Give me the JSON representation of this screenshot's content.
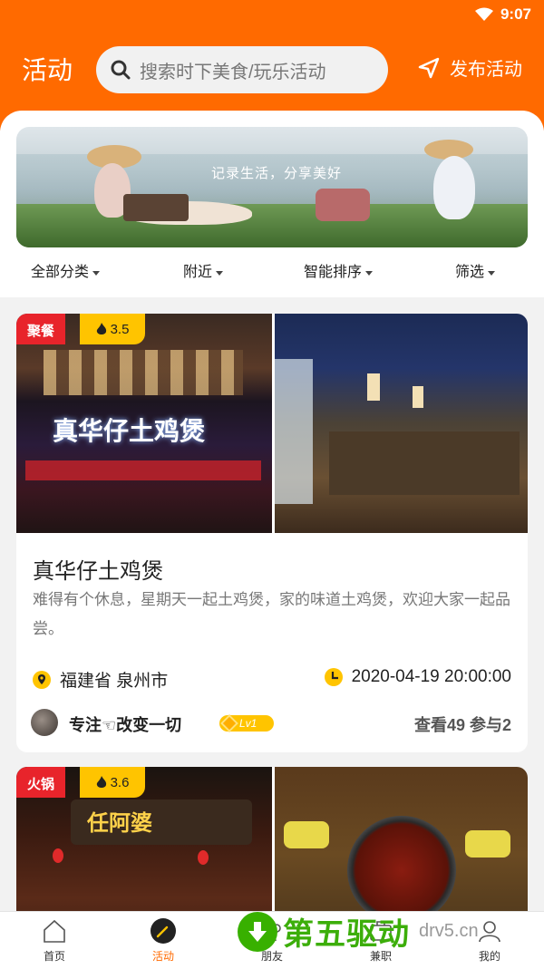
{
  "status_bar": {
    "time": "9:07"
  },
  "header": {
    "title": "活动",
    "search_placeholder": "搜索时下美食/玩乐活动",
    "publish_label": "发布活动"
  },
  "banner": {
    "slogan": "记录生活，分享美好"
  },
  "filters": [
    {
      "label": "全部分类"
    },
    {
      "label": "附近"
    },
    {
      "label": "智能排序"
    },
    {
      "label": "筛选"
    }
  ],
  "cards": [
    {
      "tag": "聚餐",
      "rating": "3.5",
      "sign_text": "真华仔土鸡煲",
      "title": "真华仔土鸡煲",
      "description": "难得有个休息，星期天一起土鸡煲，家的味道土鸡煲，欢迎大家一起品尝。",
      "location": "福建省 泉州市",
      "datetime": "2020-04-19 20:00:00",
      "username": "专注☜改变一切",
      "level": "Lv1",
      "stats": "查看49 参与2"
    },
    {
      "tag": "火锅",
      "rating": "3.6",
      "sign_text": "任阿婆"
    }
  ],
  "tabbar": [
    {
      "label": "首页",
      "icon": "home-icon"
    },
    {
      "label": "活动",
      "icon": "compass-icon",
      "active": true
    },
    {
      "label": "朋友",
      "icon": "friends-icon"
    },
    {
      "label": "兼职",
      "icon": "briefcase-icon"
    },
    {
      "label": "我的",
      "icon": "user-icon"
    }
  ],
  "watermark": {
    "text": "第五驱动",
    "domain": "drv5.cn"
  },
  "colors": {
    "brand": "#ff6a00",
    "tag_red": "#e8242b",
    "rating_yellow": "#ffc400"
  }
}
